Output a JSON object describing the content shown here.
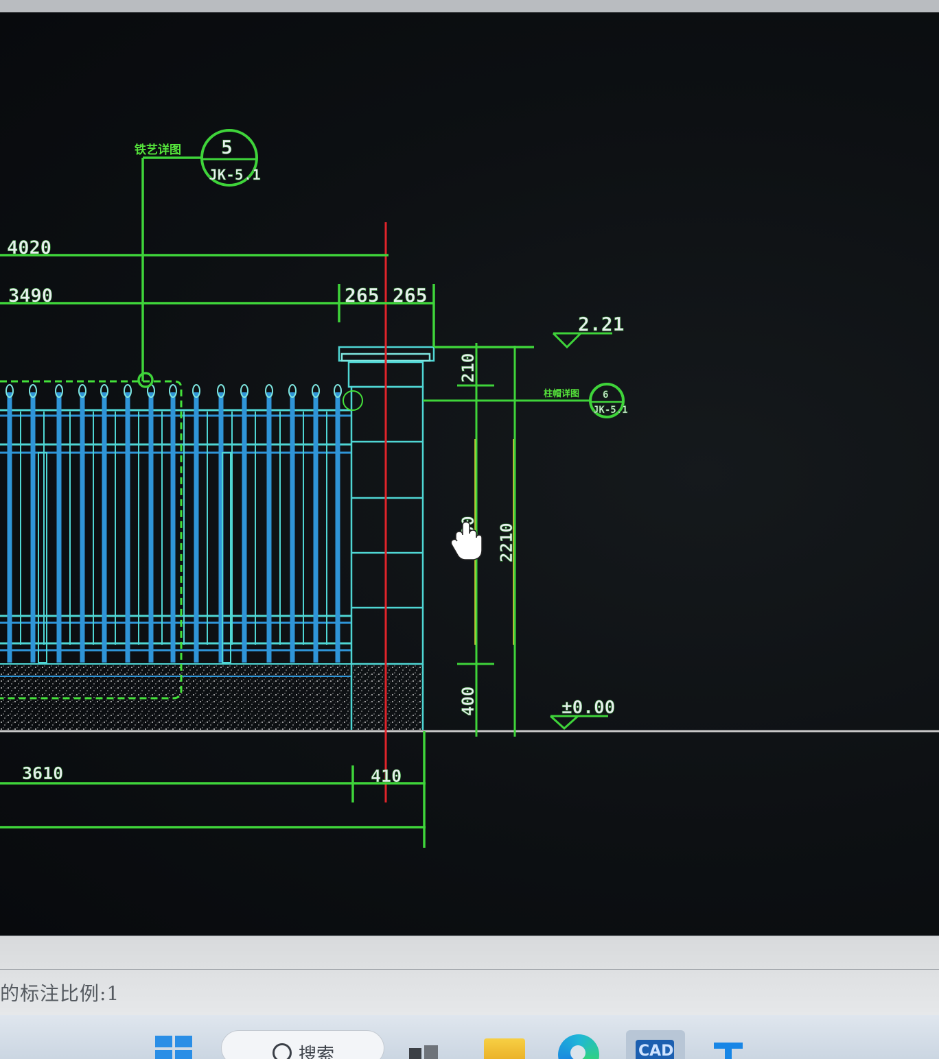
{
  "drawing": {
    "dimensions": {
      "top_overall": "4020",
      "top_span": "3490",
      "pier_left_half": "265",
      "pier_right_half": "265",
      "cap_height": "210",
      "rail_height": "1600",
      "total_height": "2210",
      "plinth_height": "400",
      "bottom_span": "3610",
      "bottom_pier": "410"
    },
    "elevations": {
      "top": "2.21",
      "ground": "±0.00"
    },
    "callouts": {
      "section_upper": {
        "label": "铁艺详图",
        "number": "5",
        "sheet": "JK-5.1"
      },
      "section_lower": {
        "label": "柱帽详图",
        "number": "6",
        "sheet": "JK-5.1"
      }
    }
  },
  "command_line": {
    "text": "的标注比例:1"
  },
  "taskbar": {
    "search_label": "搜索",
    "cad_label": "CAD"
  },
  "colors": {
    "canvas_bg": "#0c0e12",
    "dimension_green": "#3fd43a",
    "fence_blue": "#2f95d8",
    "pier_cyan": "#4fd6d4",
    "center_red": "#e0242a",
    "yellow_dim": "#d8d23a"
  }
}
